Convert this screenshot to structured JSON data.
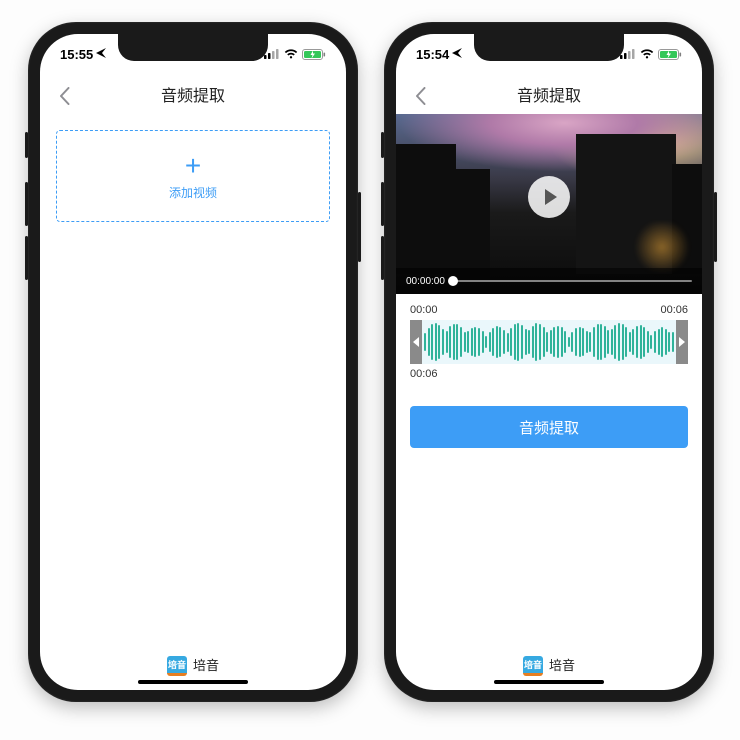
{
  "left": {
    "status_time": "15:55",
    "nav_title": "音频提取",
    "add_label": "添加视频",
    "app_name": "培音",
    "app_badge": "培音"
  },
  "right": {
    "status_time": "15:54",
    "nav_title": "音频提取",
    "video_time": "00:00:00",
    "wave_start": "00:00",
    "wave_end": "00:06",
    "wave_dur": "00:06",
    "action_label": "音频提取",
    "app_name": "培音",
    "app_badge": "培音"
  }
}
